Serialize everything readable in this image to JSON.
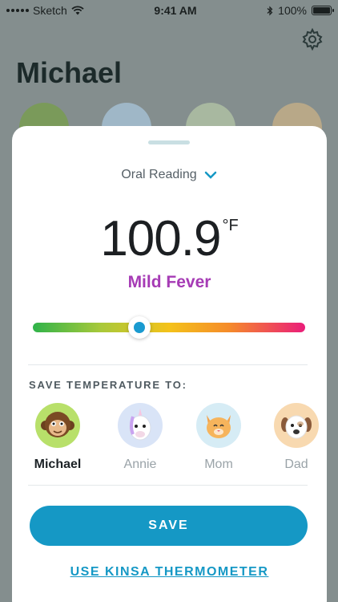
{
  "status_bar": {
    "carrier": "Sketch",
    "time": "9:41 AM",
    "battery": "100%"
  },
  "background": {
    "title": "Michael",
    "avatar_colors": [
      "#7a9a5a",
      "#9fb7c7",
      "#a8b8a0",
      "#b8a888"
    ]
  },
  "sheet": {
    "reading_type": "Oral Reading",
    "temperature": "100.9",
    "unit": "°F",
    "status": "Mild Fever",
    "status_color": "#a63bb5",
    "slider_position_pct": 39,
    "save_to_label": "SAVE TEMPERATURE TO:",
    "profiles": [
      {
        "name": "Michael",
        "selected": true,
        "bg": "#b8e06a",
        "icon": "monkey-icon"
      },
      {
        "name": "Annie",
        "selected": false,
        "bg": "#d9e4f7",
        "icon": "unicorn-icon"
      },
      {
        "name": "Mom",
        "selected": false,
        "bg": "#d6ecf5",
        "icon": "cat-icon"
      },
      {
        "name": "Dad",
        "selected": false,
        "bg": "#f8d9b0",
        "icon": "dog-icon"
      }
    ],
    "save_label": "SAVE",
    "link_label": "USE KINSA THERMOMETER",
    "accent": "#1598c5"
  }
}
